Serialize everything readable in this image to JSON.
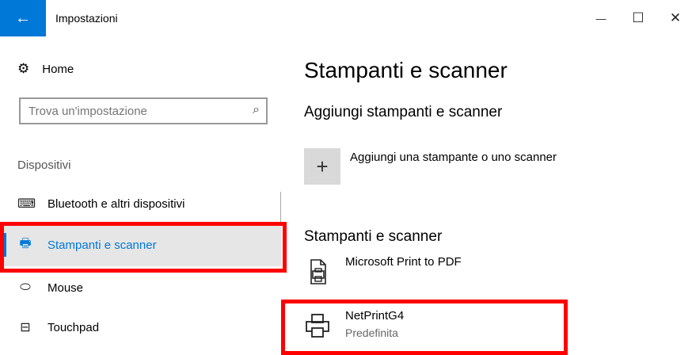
{
  "window": {
    "title": "Impostazioni",
    "back_icon": "←",
    "minimize_icon": "—",
    "maximize_icon": "☐",
    "close_icon": "✕"
  },
  "sidebar": {
    "home_label": "Home",
    "home_icon": "⚙",
    "search": {
      "placeholder": "Trova un'impostazione",
      "icon": "⌕"
    },
    "section_label": "Dispositivi",
    "items": [
      {
        "label": "Bluetooth e altri dispositivi",
        "icon": "⌨"
      },
      {
        "label": "Stampanti e scanner",
        "icon": "🖶"
      },
      {
        "label": "Mouse",
        "icon": "⬭"
      },
      {
        "label": "Touchpad",
        "icon": "⊟"
      }
    ],
    "selected_index": 1
  },
  "main": {
    "title": "Stampanti e scanner",
    "add_section_title": "Aggiungi stampanti e scanner",
    "add_button_icon": "+",
    "add_label": "Aggiungi una stampante o uno scanner",
    "list_section_title": "Stampanti e scanner",
    "printers": [
      {
        "name": "Microsoft Print to PDF",
        "status": ""
      },
      {
        "name": "NetPrintG4",
        "status": "Predefinita"
      }
    ]
  },
  "colors": {
    "accent": "#0078d7",
    "highlight": "#ff0000",
    "selected_bg": "#e6e6e6"
  }
}
